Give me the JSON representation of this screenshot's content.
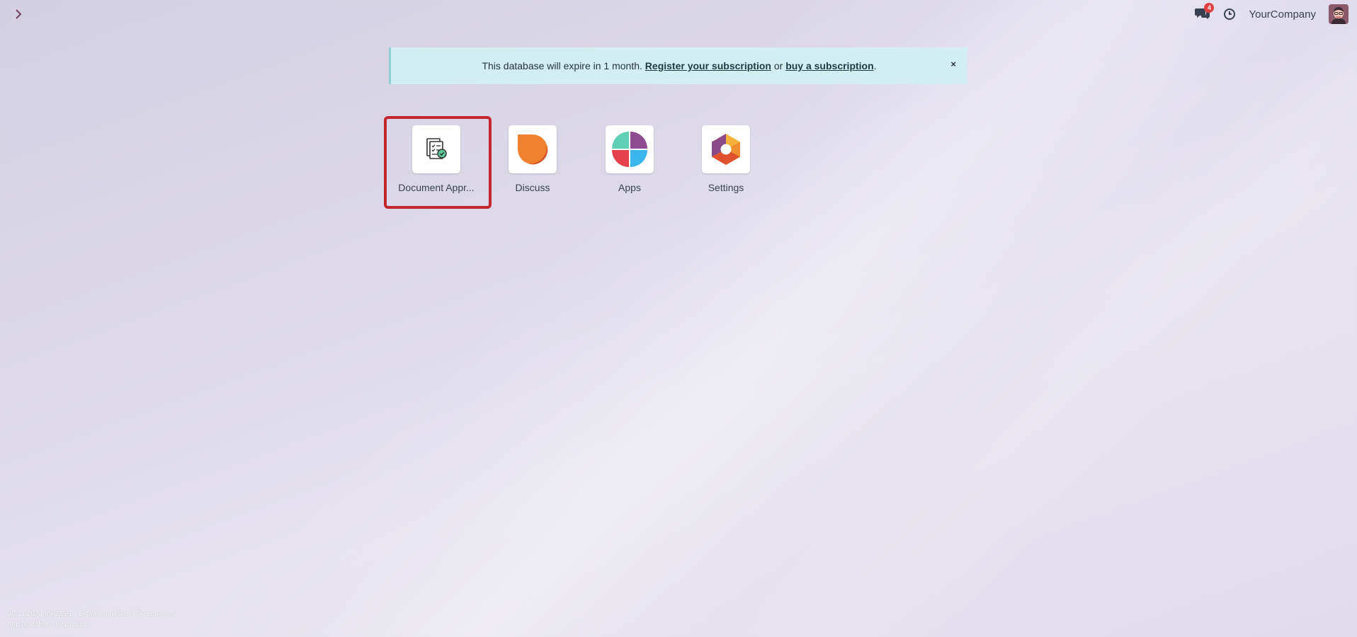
{
  "topbar": {
    "menu_toggle_glyph": "›",
    "chat_count": "4",
    "company_name": "YourCompany"
  },
  "banner": {
    "text_before": "This database will expire in 1 month.",
    "register_link": "Register your subscription",
    "middle": "or",
    "buy_link": "buy a subscription",
    "end": ".",
    "close_glyph": "×"
  },
  "apps": [
    {
      "label": "Document Appr...",
      "icon": "document-approval-icon"
    },
    {
      "label": "Discuss",
      "icon": "discuss-icon"
    },
    {
      "label": "Apps",
      "icon": "apps-icon"
    },
    {
      "label": "Settings",
      "icon": "settings-icon"
    }
  ],
  "footer": {
    "line1": "30/11/2024 09:22:21 - Explain and Send Screenshots",
    "line2": "http://localhost:8018/odoo"
  },
  "colors": {
    "accent": "#71435f",
    "highlight": "#c4262e",
    "banner_bg": "#d2eef0",
    "badge": "#e0413e"
  }
}
